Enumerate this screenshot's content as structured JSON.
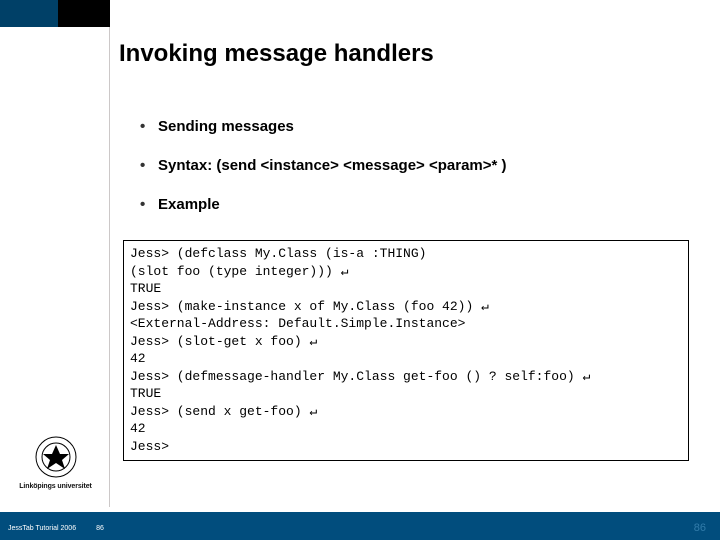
{
  "title": "Invoking message handlers",
  "bullets": [
    "Sending messages",
    "Syntax: (send <instance> <message> <param>* )",
    "Example"
  ],
  "code_lines": [
    "Jess> (defclass My.Class (is-a :THING)",
    "(slot foo (type integer))) ↵",
    "TRUE",
    "Jess> (make-instance x of My.Class (foo 42)) ↵",
    "<External-Address: Default.Simple.Instance>",
    "Jess> (slot-get x foo) ↵",
    "42",
    "Jess> (defmessage-handler My.Class get-foo () ? self:foo) ↵",
    "TRUE",
    "Jess> (send x get-foo) ↵",
    "42",
    "Jess>"
  ],
  "university": "Linköpings universitet",
  "footer": {
    "left": "JessTab Tutorial 2006",
    "page_small": "86",
    "page_big": "86"
  },
  "colors": {
    "footer_bg": "#014d7d",
    "corner_dark": "#004067"
  }
}
